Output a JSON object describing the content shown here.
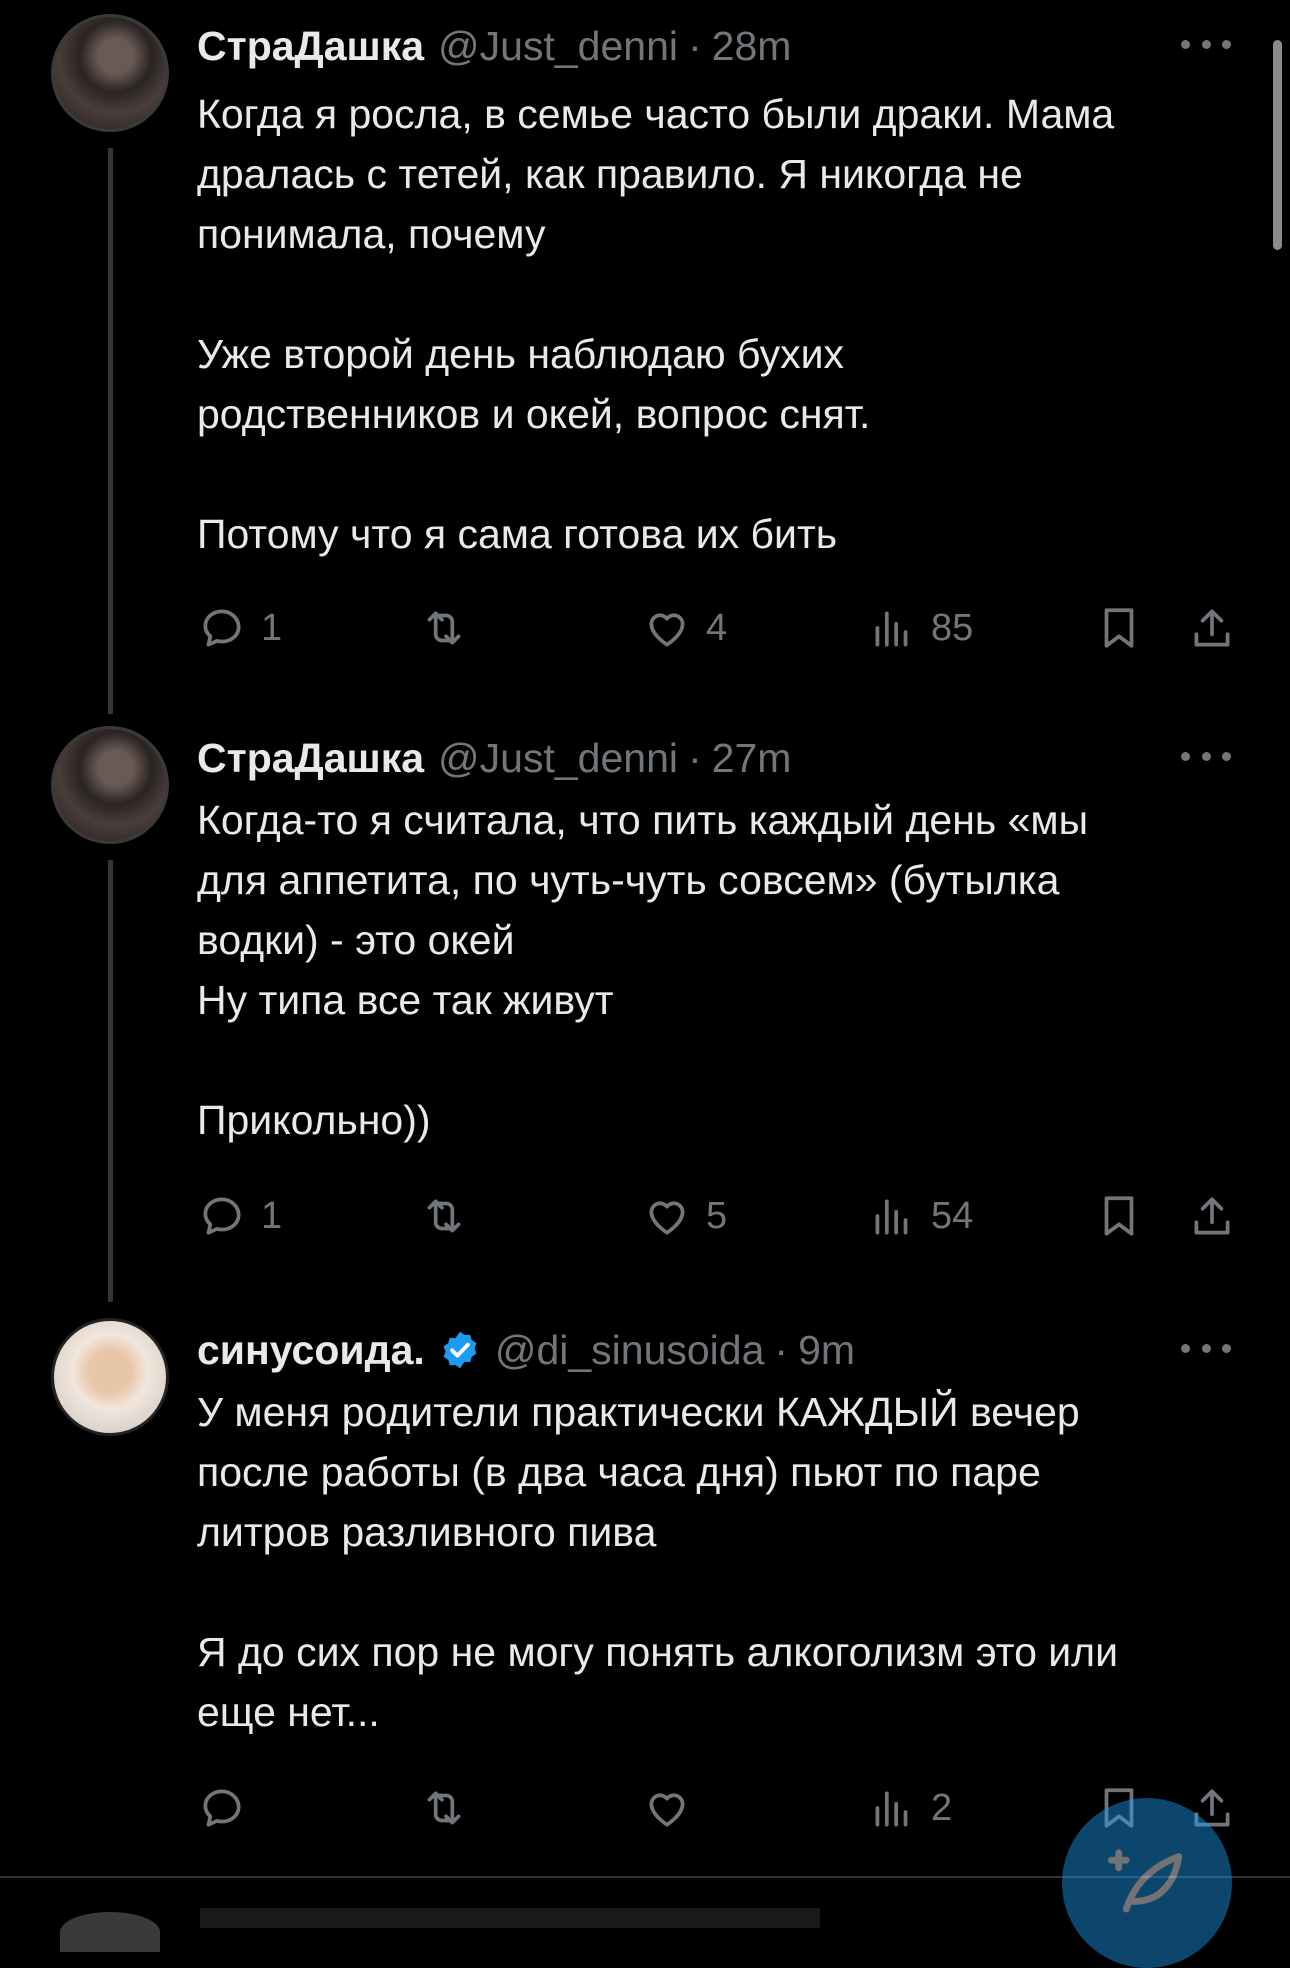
{
  "tweets": [
    {
      "name": "СтраДашка",
      "handle": "@Just_denni",
      "separator": "·",
      "time": "28m",
      "text": "Когда я росла, в семье часто были драки. Мама\nдралась с тетей, как правило. Я никогда не\nпонимала, почему\n\nУже второй день наблюдаю бухих\nродственников и окей, вопрос снят.\n\nПотому что я сама готова их бить",
      "replies": "1",
      "retweets": "",
      "likes": "4",
      "views": "85"
    },
    {
      "name": "СтраДашка",
      "handle": "@Just_denni",
      "separator": "·",
      "time": "27m",
      "text": "Когда-то я считала, что пить каждый день «мы\nдля аппетита, по чуть-чуть совсем» (бутылка\nводки) - это окей\nНу типа все так живут\n\nПрикольно))",
      "replies": "1",
      "retweets": "",
      "likes": "5",
      "views": "54"
    },
    {
      "name": "синусоида.",
      "handle": "@di_sinusoida",
      "separator": "·",
      "time": "9m",
      "verified": true,
      "text": "У меня родители практически КАЖДЫЙ вечер\nпосле работы (в два часа дня) пьют по паре\nлитров разливного пива\n\nЯ до сих пор не могу понять алкоголизм это или\nеще нет...",
      "replies": "",
      "retweets": "",
      "likes": "",
      "views": "2"
    }
  ],
  "icons": {
    "reply": "reply-icon",
    "retweet": "retweet-icon",
    "like": "heart-icon",
    "views": "views-icon",
    "bookmark": "bookmark-icon",
    "share": "share-icon",
    "compose": "compose-icon"
  },
  "colors": {
    "background": "#000000",
    "text": "#e7e9ea",
    "secondary": "#71767b",
    "accent": "#1d9bf0"
  }
}
